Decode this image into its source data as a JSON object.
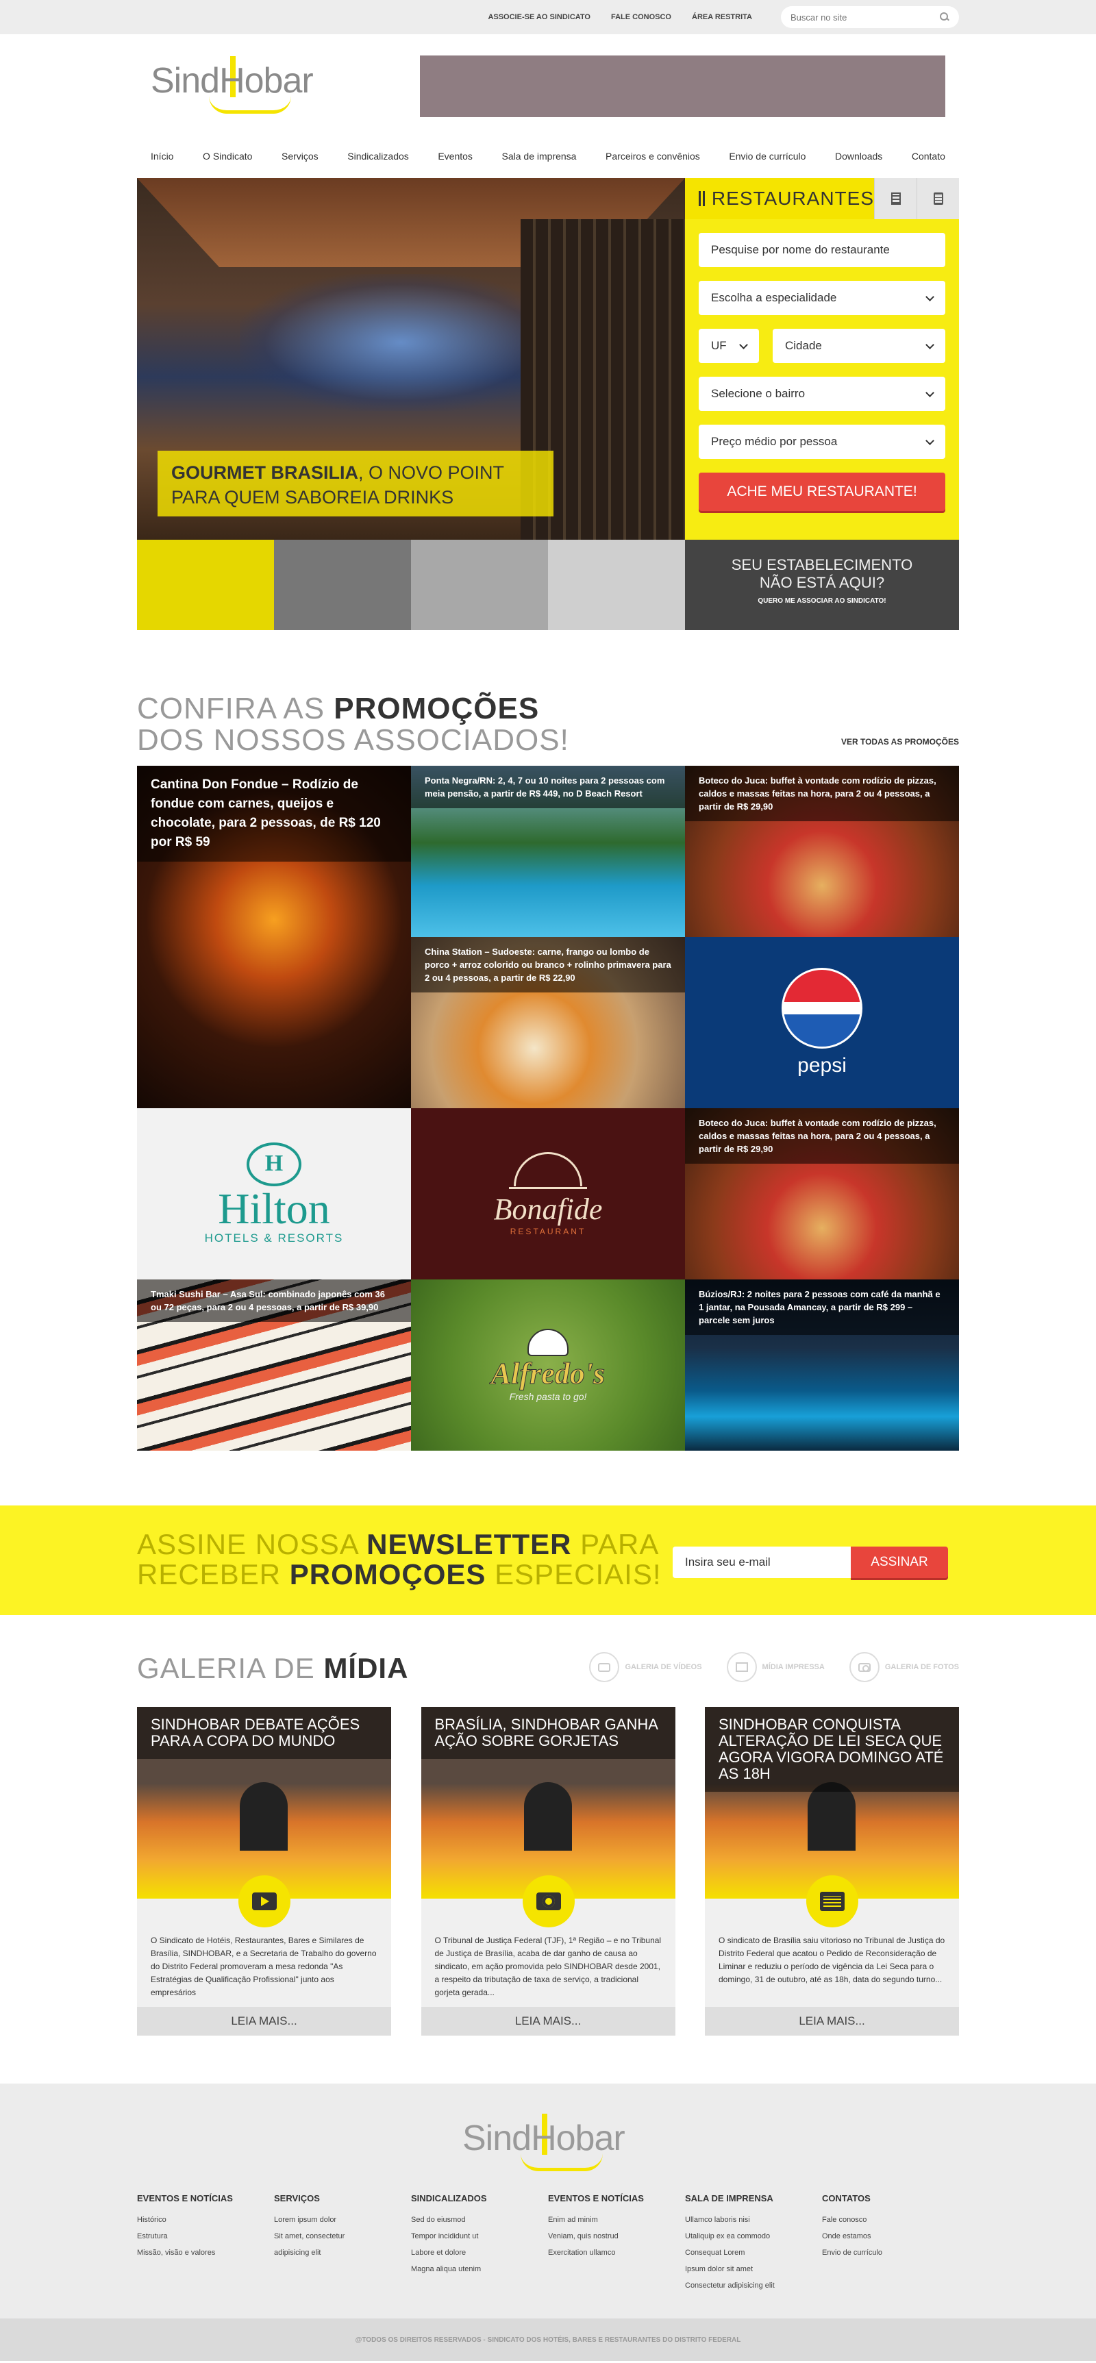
{
  "topbar": {
    "links": [
      "ASSOCIE-SE AO SINDICATO",
      "FALE CONOSCO",
      "ÁREA RESTRITA"
    ],
    "search_placeholder": "Buscar no site"
  },
  "logo": {
    "text": "SindHobar"
  },
  "nav": {
    "items": [
      "Início",
      "O Sindicato",
      "Serviços",
      "Sindicalizados",
      "Eventos",
      "Sala de imprensa",
      "Parceiros e convênios",
      "Envio de currículo",
      "Downloads",
      "Contato"
    ]
  },
  "hero": {
    "caption_bold": "GOURMET BRASILIA",
    "caption_line1_rest": ", O NOVO POINT",
    "caption_line2": "PARA QUEM SABOREIA DRINKS"
  },
  "restaurants": {
    "tab_label": "RESTAURANTES",
    "name_placeholder": "Pesquise por nome do restaurante",
    "specialty": "Escolha a especialidade",
    "uf": "UF",
    "city": "Cidade",
    "neighborhood": "Selecione o bairro",
    "price": "Preço médio por pessoa",
    "button": "ACHE MEU RESTAURANTE!"
  },
  "associate": {
    "line1": "SEU ESTABELECIMENTO",
    "line2": "NÃO ESTÁ AQUI?",
    "link": "QUERO ME ASSOCIAR AO SINDICATO!"
  },
  "promos": {
    "title_light1": "CONFIRA AS ",
    "title_bold": "PROMOÇÕES",
    "title_light2": "DOS NOSSOS ASSOCIADOS!",
    "see_all": "VER TODAS AS PROMOÇÕES",
    "fondue": "Cantina Don Fondue – Rodízio de fondue com carnes, queijos e chocolate, para 2 pessoas, de R$ 120 por R$ 59",
    "pool": "Ponta Negra/RN: 2, 4, 7 ou 10 noites para 2 pessoas com meia pensão, a partir de R$ 449, no D Beach Resort",
    "pizza": "Boteco do Juca: buffet à vontade com rodízio de pizzas, caldos e massas feitas na hora, para 2 ou 4 pessoas, a partir de R$ 29,90",
    "china": "China Station – Sudoeste: carne, frango ou lombo de porco + arroz colorido ou branco + rolinho primavera para 2 ou 4 pessoas, a partir de R$ 22,90",
    "pepsi": "pepsi",
    "hilton_name": "Hilton",
    "hilton_sub": "HOTELS & RESORTS",
    "bonafide_name": "Bonafide",
    "bonafide_sub": "RESTAURANT",
    "pizza2": "Boteco do Juca: buffet à vontade com rodízio de pizzas, caldos e massas feitas na hora, para 2 ou 4 pessoas, a partir de R$ 29,90",
    "sushi": "Tmaki Sushi Bar – Asa Sul: combinado japonês com 36 ou 72 peças, para 2 ou 4 pessoas, a partir de R$ 39,90",
    "alfredo_name": "Alfredo's",
    "alfredo_sub": "Fresh pasta to go!",
    "buzios": "Búzios/RJ: 2 noites para 2 pessoas com café da manhã e 1 jantar, na Pousada Amancay, a partir de R$ 299 – parcele sem juros"
  },
  "newsletter": {
    "l1a": "ASSINE NOSSA ",
    "l1b": "NEWSLETTER",
    "l1c": " PARA",
    "l2a": "RECEBER ",
    "l2b": "PROMOÇOES",
    "l2c": " ESPECIAIS!",
    "placeholder": "Insira seu e-mail",
    "button": "ASSINAR"
  },
  "gallery": {
    "title_light": "GALERIA DE ",
    "title_bold": "MÍDIA",
    "filters": [
      "GALERIA DE VÍDEOS",
      "MÍDIA IMPRESSA",
      "GALERIA DE FOTOS"
    ],
    "cards": [
      {
        "title": "SINDHOBAR DEBATE AÇÕES PARA A COPA DO MUNDO",
        "text": "O Sindicato de Hotéis, Restaurantes, Bares e Similares de Brasília, SINDHOBAR, e a Secretaria de Trabalho do governo do Distrito Federal promoveram a mesa redonda \"As Estratégias de Qualificação Profissional\" junto aos empresários",
        "more": "LEIA MAIS..."
      },
      {
        "title": "BRASÍLIA, SINDHOBAR GANHA AÇÃO SOBRE GORJETAS",
        "text": "O Tribunal de Justiça Federal (TJF), 1ª Região – e no Tribunal de Justiça de Brasília, acaba de dar ganho de causa ao sindicato, em ação promovida pelo SINDHOBAR desde 2001, a respeito da tributação de taxa de serviço, a tradicional gorjeta gerada...",
        "more": "LEIA MAIS..."
      },
      {
        "title": "SINDHOBAR CONQUISTA ALTERAÇÃO DE LEI SECA QUE AGORA VIGORA DOMINGO ATÉ AS 18H",
        "text": "O sindicato de Brasília saiu vitorioso no Tribunal de Justiça do Distrito Federal que acatou o Pedido de Reconsideração de Liminar e reduziu o período de vigência da Lei Seca para o domingo, 31 de outubro, até as 18h, data do segundo turno...",
        "more": "LEIA MAIS..."
      }
    ]
  },
  "footer": {
    "cols": [
      {
        "h": "EVENTOS E NOTÍCIAS",
        "links": [
          "Histórico",
          "Estrutura",
          "Missão, visão e valores"
        ]
      },
      {
        "h": "SERVIÇOS",
        "links": [
          "Lorem ipsum dolor",
          "Sit amet, consectetur",
          "adipisicing elit"
        ]
      },
      {
        "h": "SINDICALIZADOS",
        "links": [
          "Sed do eiusmod",
          "Tempor incididunt ut",
          "Labore et dolore",
          "Magna aliqua utenim"
        ]
      },
      {
        "h": "EVENTOS E NOTÍCIAS",
        "links": [
          "Enim ad minim",
          "Veniam, quis nostrud",
          "Exercitation ullamco"
        ]
      },
      {
        "h": "SALA DE IMPRENSA",
        "links": [
          "Ullamco laboris nisi",
          "Utaliquip ex ea commodo",
          "Consequat Lorem",
          "Ipsum dolor sit amet",
          "Consectetur adipisicing elit"
        ]
      },
      {
        "h": "CONTATOS",
        "links": [
          "Fale conosco",
          "Onde estamos",
          "Envio de currículo"
        ]
      }
    ],
    "copyright": "@TODOS OS DIREITOS RESERVADOS - SINDICATO DOS HOTÉIS, BARES E RESTAURANTES DO DISTRITO FEDERAL"
  }
}
